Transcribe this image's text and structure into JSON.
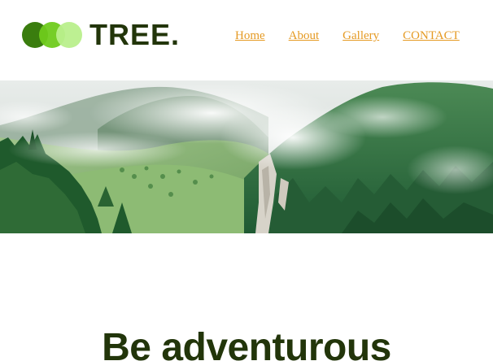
{
  "brand": {
    "name": "TREE.",
    "colors": {
      "primary_dark": "#22350a",
      "circle_1": "#3a7d0e",
      "circle_2": "#6fcb1c",
      "circle_3": "#b9ef8c",
      "link": "#e59a23"
    }
  },
  "nav": {
    "items": [
      {
        "label": "Home"
      },
      {
        "label": "About"
      },
      {
        "label": "Gallery"
      },
      {
        "label": "CONTACT"
      }
    ]
  },
  "hero": {
    "image_subject": "misty forested mountain valley"
  },
  "main": {
    "headline": "Be adventurous"
  }
}
